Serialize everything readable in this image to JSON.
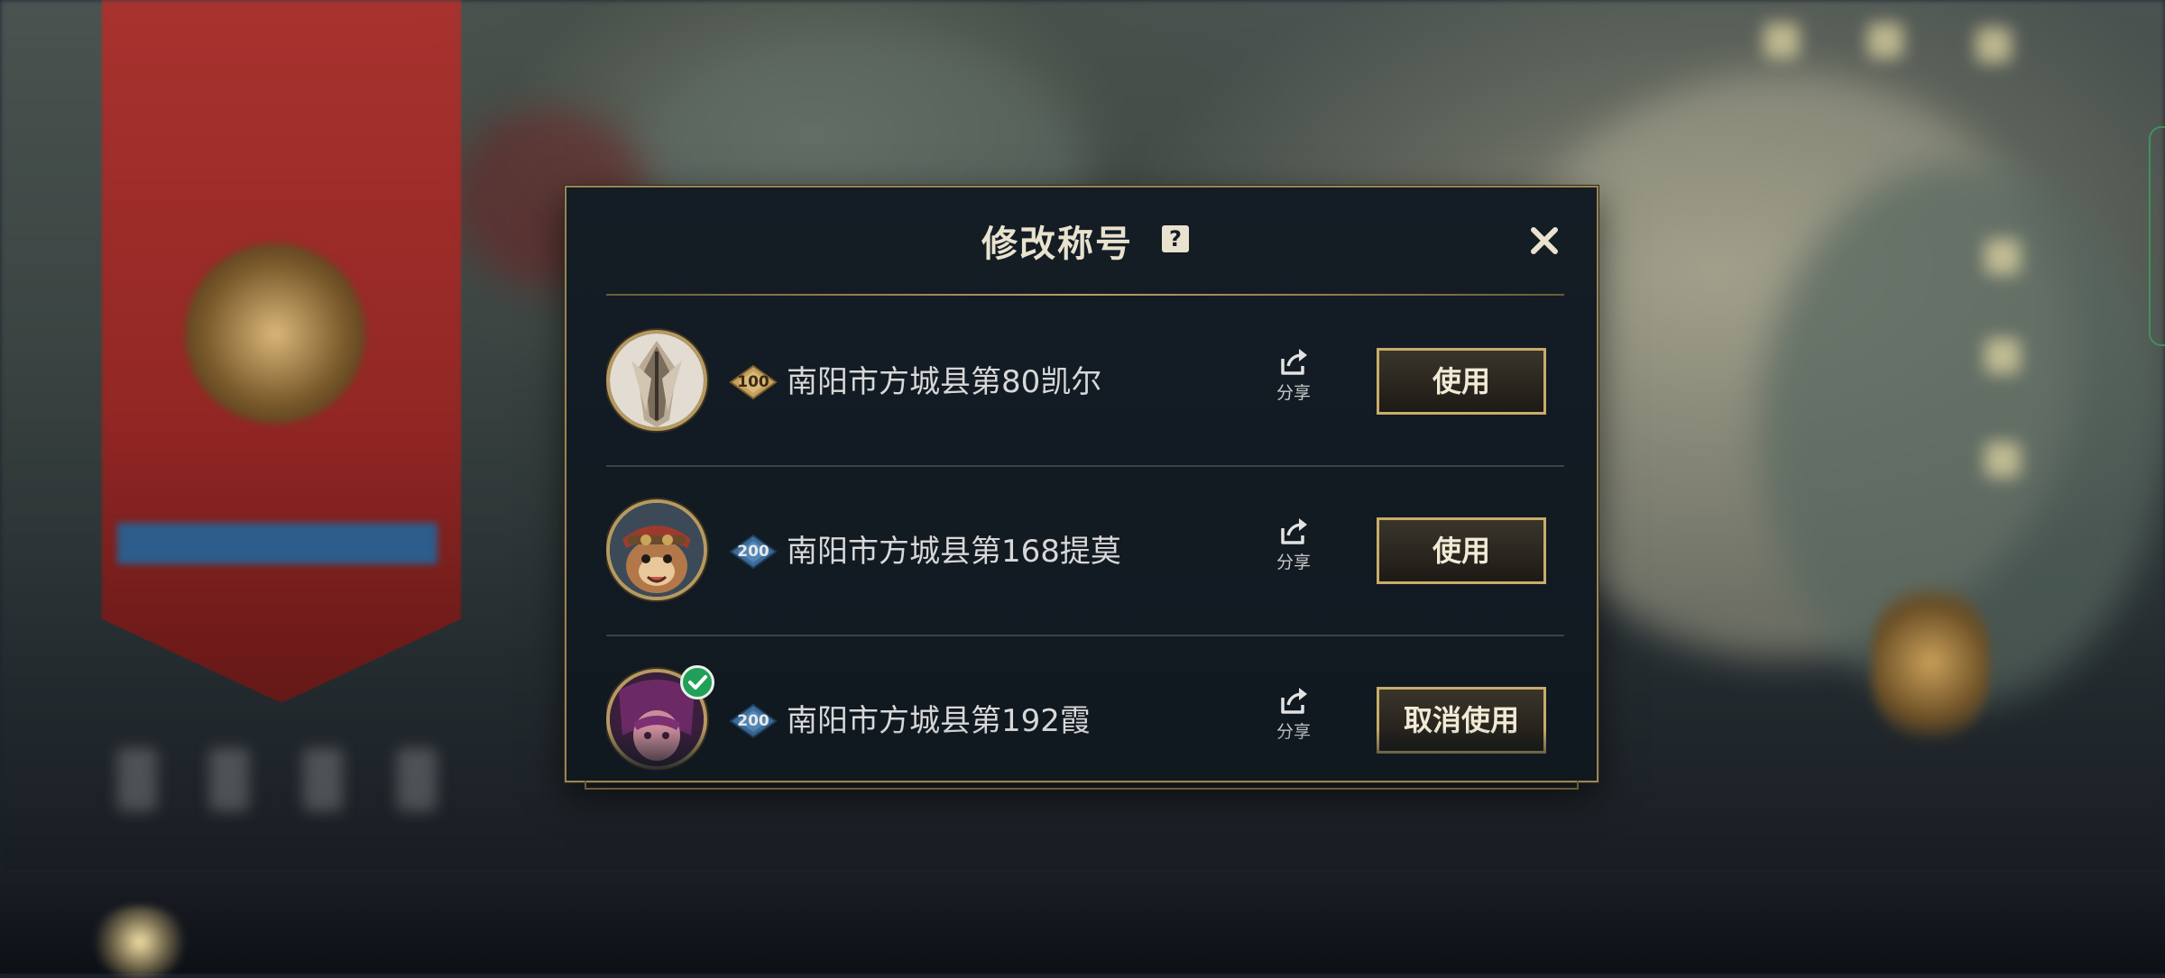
{
  "modal": {
    "title": "修改称号",
    "help_icon_glyph": "?",
    "close_icon": "close-icon"
  },
  "titles": [
    {
      "level": "100",
      "level_badge_color": "gold",
      "name": "南阳市方城县第80凯尔",
      "share_label": "分享",
      "action_label": "使用",
      "selected": false,
      "avatar_icon": "kayle-avatar-icon"
    },
    {
      "level": "200",
      "level_badge_color": "blue",
      "name": "南阳市方城县第168提莫",
      "share_label": "分享",
      "action_label": "使用",
      "selected": false,
      "avatar_icon": "teemo-avatar-icon"
    },
    {
      "level": "200",
      "level_badge_color": "blue",
      "name": "南阳市方城县第192霞",
      "share_label": "分享",
      "action_label": "取消使用",
      "selected": true,
      "avatar_icon": "xayah-avatar-icon"
    }
  ],
  "colors": {
    "accent_gold": "#c8ac6a",
    "selected_check": "#22a05a",
    "modal_bg": "#141d25"
  }
}
